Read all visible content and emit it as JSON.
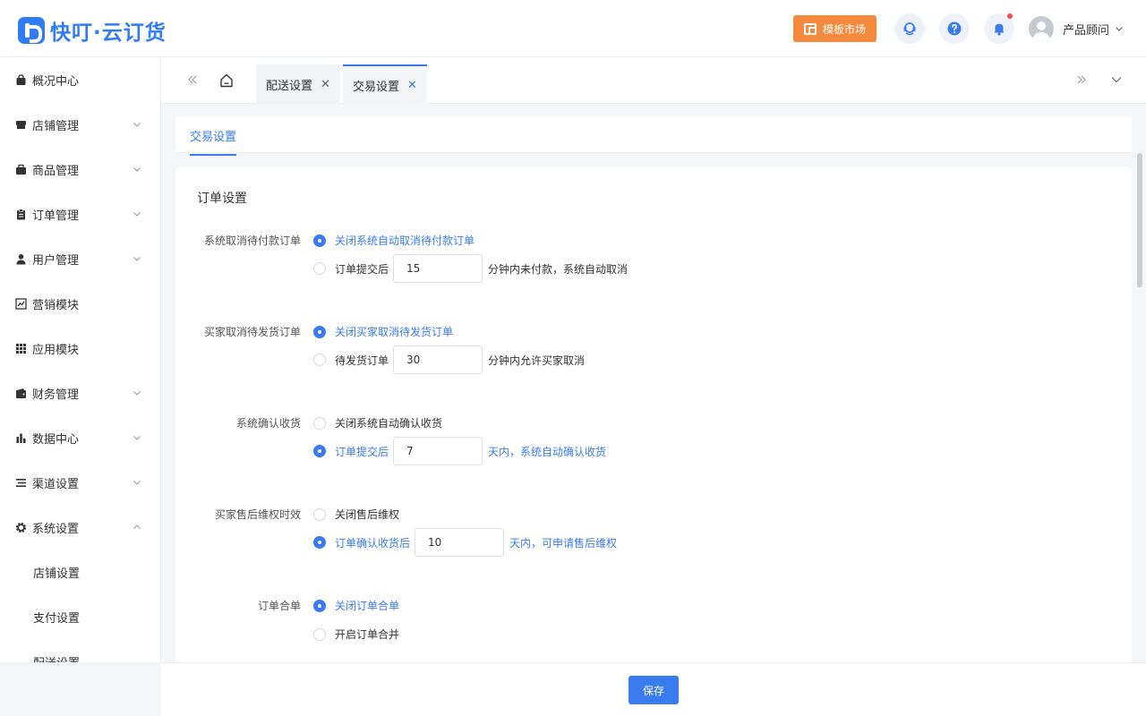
{
  "header": {
    "logo_text": "快叮·云订货",
    "market_button": "模板市场",
    "user_name": "产品顾问"
  },
  "sidebar": {
    "items": [
      {
        "label": "概况中心",
        "icon": "bag-icon",
        "expandable": false
      },
      {
        "label": "店铺管理",
        "icon": "store-icon",
        "expandable": true
      },
      {
        "label": "商品管理",
        "icon": "box-icon",
        "expandable": true
      },
      {
        "label": "订单管理",
        "icon": "clipboard-icon",
        "expandable": true
      },
      {
        "label": "用户管理",
        "icon": "user-icon",
        "expandable": true
      },
      {
        "label": "营销模块",
        "icon": "trend-icon",
        "expandable": false
      },
      {
        "label": "应用模块",
        "icon": "apps-icon",
        "expandable": false
      },
      {
        "label": "财务管理",
        "icon": "wallet-icon",
        "expandable": true
      },
      {
        "label": "数据中心",
        "icon": "bar-chart-icon",
        "expandable": true
      },
      {
        "label": "渠道设置",
        "icon": "list-icon",
        "expandable": true
      },
      {
        "label": "系统设置",
        "icon": "gear-icon",
        "expandable": true,
        "expanded": true
      }
    ],
    "sub_items": [
      "店铺设置",
      "支付设置",
      "配送设置"
    ]
  },
  "tabs": [
    {
      "label": "配送设置",
      "active": false
    },
    {
      "label": "交易设置",
      "active": true
    }
  ],
  "card_tab": "交易设置",
  "section_title": "订单设置",
  "settings": {
    "cancel_unpaid": {
      "label": "系统取消待付款订单",
      "opt1": "关闭系统自动取消待付款订单",
      "opt2_prefix": "订单提交后",
      "opt2_value": "15",
      "opt2_suffix": "分钟内未付款，系统自动取消",
      "selected": 1
    },
    "buyer_cancel": {
      "label": "买家取消待发货订单",
      "opt1": "关闭买家取消待发货订单",
      "opt2_prefix": "待发货订单",
      "opt2_value": "30",
      "opt2_suffix": "分钟内允许买家取消",
      "selected": 1
    },
    "auto_confirm": {
      "label": "系统确认收货",
      "opt1": "关闭系统自动确认收货",
      "opt2_prefix": "订单提交后",
      "opt2_value": "7",
      "opt2_suffix": "天内，系统自动确认收货",
      "selected": 2
    },
    "after_sale": {
      "label": "买家售后维权时效",
      "opt1": "关闭售后维权",
      "opt2_prefix": "订单确认收货后",
      "opt2_value": "10",
      "opt2_suffix": "天内，可申请售后维权",
      "selected": 2
    },
    "merge": {
      "label": "订单合单",
      "opt1": "关闭订单合单",
      "opt2": "开启订单合并",
      "selected": 1
    }
  },
  "footer": {
    "save_label": "保存"
  },
  "colors": {
    "primary": "#3a7bf0",
    "market_orange": "#f58a3c",
    "notification_red": "#f0504a"
  }
}
